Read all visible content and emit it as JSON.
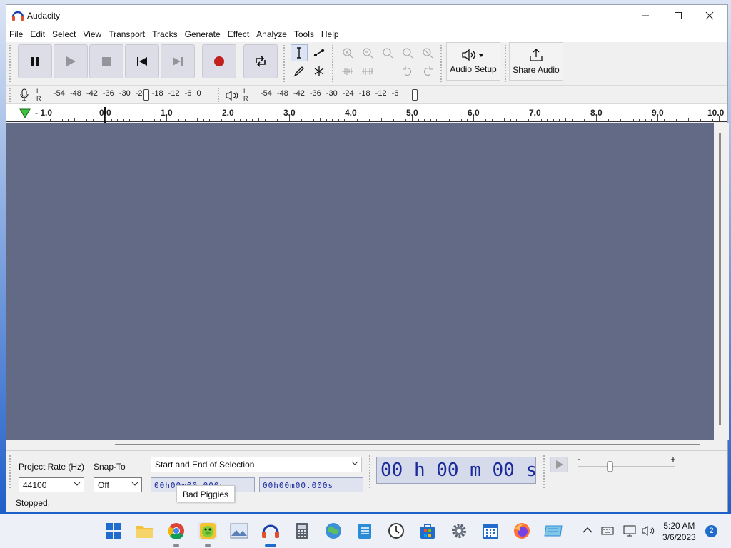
{
  "window": {
    "title": "Audacity"
  },
  "menu": [
    "File",
    "Edit",
    "Select",
    "View",
    "Transport",
    "Tracks",
    "Generate",
    "Effect",
    "Analyze",
    "Tools",
    "Help"
  ],
  "toolbar": {
    "transport": [
      "pause-icon",
      "play-icon",
      "stop-icon",
      "skip-to-start-icon",
      "skip-to-end-icon",
      "record-icon",
      "loop-icon"
    ],
    "record_color": "#c0201e",
    "audio_setup_label": "Audio Setup",
    "share_audio_label": "Share Audio"
  },
  "meters": {
    "record_ticks": "-54 -48 -42 -36 -30 -24 -18 -12 -6 0",
    "playback_ticks": "-54 -48 -42 -36 -30 -24 -18 -12 -6",
    "l": "L",
    "r": "R"
  },
  "ruler": {
    "labels": [
      "- 1.0",
      "0.0",
      "1.0",
      "2.0",
      "3.0",
      "4.0",
      "5.0",
      "6.0",
      "7.0",
      "8.0",
      "9.0",
      "10.0"
    ]
  },
  "colors": {
    "track_bg": "#636a86",
    "time_text": "#1a2a9a"
  },
  "selection": {
    "project_rate_label": "Project Rate (Hz)",
    "project_rate_value": "44100",
    "snap_to_label": "Snap-To",
    "snap_to_value": "Off",
    "mode": "Start and End of Selection",
    "start_time": "00h00m00.000s",
    "end_time": "00h00m00.000s",
    "audio_position": "00 h 00 m 00 s"
  },
  "status": "Stopped.",
  "tooltip": "Bad Piggies",
  "taskbar": {
    "apps": [
      "windows-start-icon",
      "file-explorer-icon",
      "chrome-icon",
      "bad-piggies-icon",
      "photos-icon",
      "audacity-icon",
      "calculator-icon",
      "maps-icon",
      "notepad-icon",
      "clock-icon",
      "store-icon",
      "settings-icon",
      "calendar-icon",
      "firefox-icon",
      "remote-icon"
    ],
    "time": "5:20 AM",
    "date": "3/6/2023",
    "notifications": "2"
  }
}
